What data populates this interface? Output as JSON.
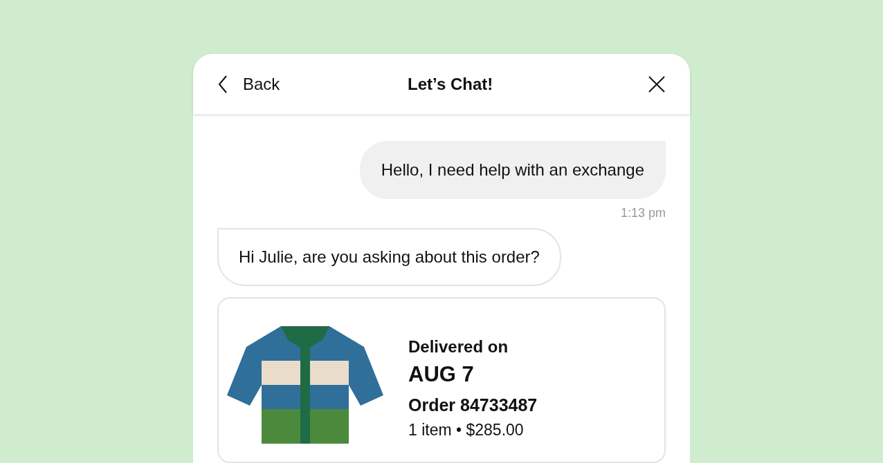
{
  "header": {
    "back_label": "Back",
    "title": "Let’s Chat!"
  },
  "messages": [
    {
      "kind": "outgoing",
      "text": "Hello, I need help with an exchange",
      "time": "1:13 pm"
    },
    {
      "kind": "incoming",
      "text": "Hi Julie, are you asking about this order?"
    },
    {
      "kind": "order",
      "delivered_label": "Delivered on",
      "delivered_date": "AUG 7",
      "order": "Order 84733487",
      "summary": "1 item • $285.00"
    }
  ]
}
